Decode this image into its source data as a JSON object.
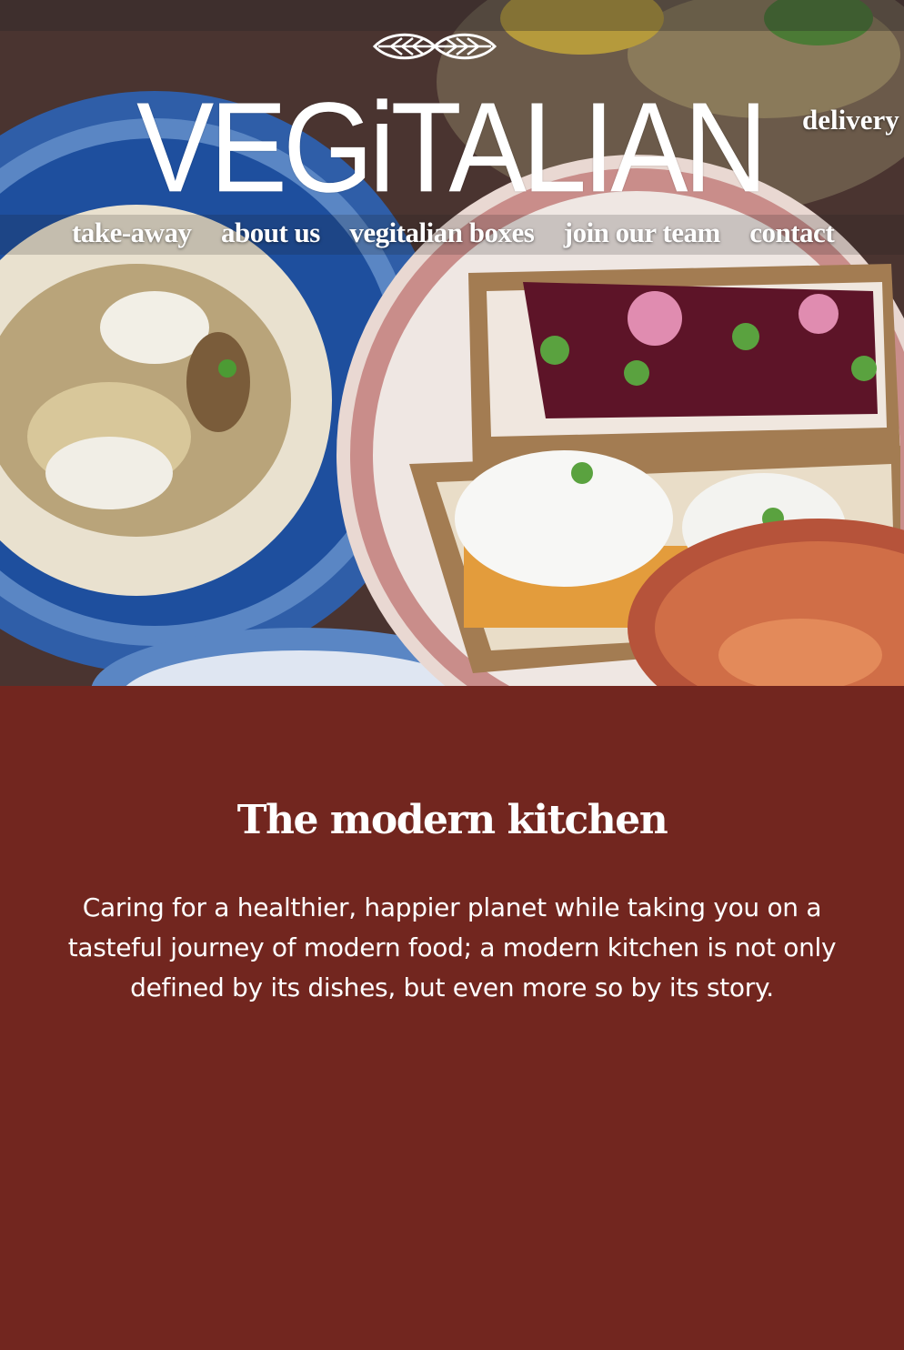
{
  "brand": {
    "name": "VEGiTALIAN"
  },
  "header": {
    "delivery_label": "delivery"
  },
  "nav": {
    "items": [
      {
        "label": "take-away"
      },
      {
        "label": "about us"
      },
      {
        "label": "vegitalian boxes"
      },
      {
        "label": "join our team"
      },
      {
        "label": "contact"
      }
    ]
  },
  "intro": {
    "title": "The modern kitchen",
    "text": "Caring for a healthier, happier planet while taking you on a tasteful journey of modern food; a modern kitchen is not only defined by its dishes, but even more so by its story."
  },
  "colors": {
    "section_background": "#72261f",
    "text": "#ffffff"
  },
  "icons": {
    "logo": "olive-leaf-icon"
  }
}
